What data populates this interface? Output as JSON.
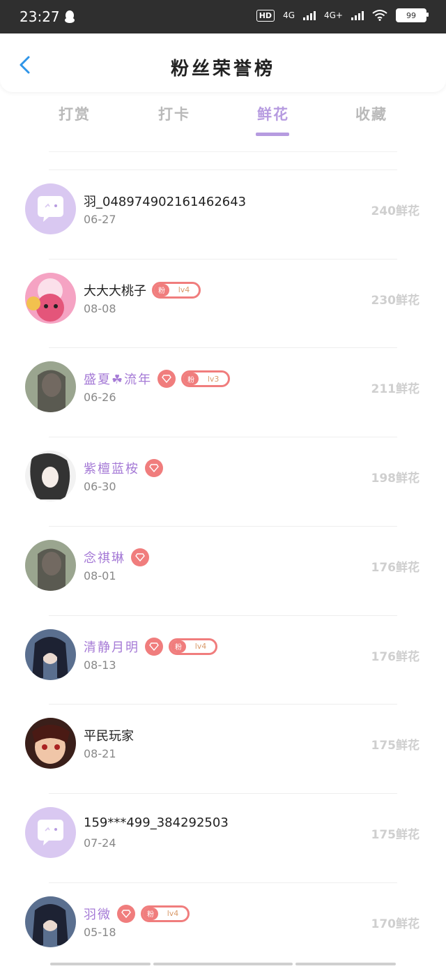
{
  "status": {
    "time": "23:27",
    "hd": "HD",
    "net1": "4G",
    "net2": "4G+",
    "battery": "99"
  },
  "header": {
    "title": "粉丝荣誉榜"
  },
  "tabs": [
    "打赏",
    "打卡",
    "鲜花",
    "收藏"
  ],
  "active_tab": 2,
  "badge_fan_label": "粉",
  "rows": [
    {
      "name": "羽_048974902161462643",
      "date": "06-27",
      "amount": "240鲜花",
      "vip": false,
      "diamond": false,
      "level": "",
      "avatar": "placeholder"
    },
    {
      "name": "大大大桃子",
      "date": "08-08",
      "amount": "230鲜花",
      "vip": false,
      "diamond": false,
      "level": "lv4",
      "avatar": "cartoon"
    },
    {
      "name": "盛夏☘流年",
      "date": "06-26",
      "amount": "211鲜花",
      "vip": true,
      "diamond": true,
      "level": "lv3",
      "avatar": "photo"
    },
    {
      "name": "紫檀蓝桉",
      "date": "06-30",
      "amount": "198鲜花",
      "vip": true,
      "diamond": true,
      "level": "",
      "avatar": "sketch"
    },
    {
      "name": "念祺琳",
      "date": "08-01",
      "amount": "176鲜花",
      "vip": true,
      "diamond": true,
      "level": "",
      "avatar": "photo"
    },
    {
      "name": "清静月明",
      "date": "08-13",
      "amount": "176鲜花",
      "vip": true,
      "diamond": true,
      "level": "lv4",
      "avatar": "anime"
    },
    {
      "name": "平民玩家",
      "date": "08-21",
      "amount": "175鲜花",
      "vip": false,
      "diamond": false,
      "level": "",
      "avatar": "anime-red"
    },
    {
      "name": "159***499_384292503",
      "date": "07-24",
      "amount": "175鲜花",
      "vip": false,
      "diamond": false,
      "level": "",
      "avatar": "placeholder"
    },
    {
      "name": "羽微",
      "date": "05-18",
      "amount": "170鲜花",
      "vip": true,
      "diamond": true,
      "level": "lv4",
      "avatar": "anime"
    }
  ],
  "colors": {
    "accent": "#b69be0",
    "vip_name": "#a57ad6",
    "badge": "#f07d7d",
    "back_arrow": "#2f95e8"
  }
}
